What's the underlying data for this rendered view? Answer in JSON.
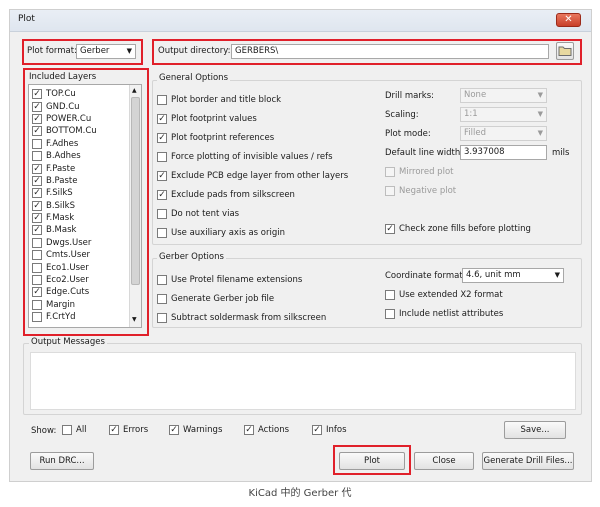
{
  "window": {
    "title": "Plot",
    "close_glyph": "✕"
  },
  "plot_format": {
    "label": "Plot format:",
    "value": "Gerber"
  },
  "output_directory": {
    "label": "Output directory:",
    "value": "GERBERS\\"
  },
  "included_layers": {
    "title": "Included Layers",
    "items": [
      {
        "label": "TOP.Cu",
        "checked": true
      },
      {
        "label": "GND.Cu",
        "checked": true
      },
      {
        "label": "POWER.Cu",
        "checked": true
      },
      {
        "label": "BOTTOM.Cu",
        "checked": true
      },
      {
        "label": "F.Adhes",
        "checked": false
      },
      {
        "label": "B.Adhes",
        "checked": false
      },
      {
        "label": "F.Paste",
        "checked": true
      },
      {
        "label": "B.Paste",
        "checked": true
      },
      {
        "label": "F.SilkS",
        "checked": true
      },
      {
        "label": "B.SilkS",
        "checked": true
      },
      {
        "label": "F.Mask",
        "checked": true
      },
      {
        "label": "B.Mask",
        "checked": true
      },
      {
        "label": "Dwgs.User",
        "checked": false
      },
      {
        "label": "Cmts.User",
        "checked": false
      },
      {
        "label": "Eco1.User",
        "checked": false
      },
      {
        "label": "Eco2.User",
        "checked": false
      },
      {
        "label": "Edge.Cuts",
        "checked": true
      },
      {
        "label": "Margin",
        "checked": false
      },
      {
        "label": "F.CrtYd",
        "checked": false
      }
    ]
  },
  "general_options": {
    "title": "General Options",
    "checkboxes": [
      {
        "label": "Plot border and title block",
        "checked": false
      },
      {
        "label": "Plot footprint values",
        "checked": true
      },
      {
        "label": "Plot footprint references",
        "checked": true
      },
      {
        "label": "Force plotting of invisible values / refs",
        "checked": false
      },
      {
        "label": "Exclude PCB edge layer from other layers",
        "checked": true
      },
      {
        "label": "Exclude pads from silkscreen",
        "checked": true
      },
      {
        "label": "Do not tent vias",
        "checked": false
      },
      {
        "label": "Use auxiliary axis as origin",
        "checked": false
      }
    ],
    "drill_marks": {
      "label": "Drill marks:",
      "value": "None"
    },
    "scaling": {
      "label": "Scaling:",
      "value": "1:1"
    },
    "plot_mode": {
      "label": "Plot mode:",
      "value": "Filled"
    },
    "line_width": {
      "label": "Default line width:",
      "value": "3.937008",
      "unit": "mils"
    },
    "mirrored_plot": {
      "label": "Mirrored plot",
      "checked": false
    },
    "negative_plot": {
      "label": "Negative plot",
      "checked": false
    },
    "check_zone_fills": {
      "label": "Check zone fills before plotting",
      "checked": true
    }
  },
  "gerber_options": {
    "title": "Gerber Options",
    "checkboxes": [
      {
        "label": "Use Protel filename extensions",
        "checked": false
      },
      {
        "label": "Generate Gerber job file",
        "checked": false
      },
      {
        "label": "Subtract soldermask from silkscreen",
        "checked": false
      }
    ],
    "coordinate_format": {
      "label": "Coordinate format:",
      "value": "4.6, unit mm"
    },
    "extended_x2": {
      "label": "Use extended X2 format",
      "checked": false
    },
    "netlist_attributes": {
      "label": "Include netlist attributes",
      "checked": false
    }
  },
  "output_messages": {
    "title": "Output Messages"
  },
  "show_filter": {
    "label": "Show:",
    "items": [
      {
        "label": "All",
        "checked": false
      },
      {
        "label": "Errors",
        "checked": true
      },
      {
        "label": "Warnings",
        "checked": true
      },
      {
        "label": "Actions",
        "checked": true
      },
      {
        "label": "Infos",
        "checked": true
      }
    ]
  },
  "buttons": {
    "save": "Save...",
    "run_drc": "Run DRC...",
    "plot": "Plot",
    "close": "Close",
    "generate_drill": "Generate Drill Files..."
  },
  "caption": "KiCad 中的 Gerber 代",
  "icons": {
    "check": "✓",
    "dropdown": "▼",
    "scroll_up": "▲",
    "scroll_down": "▼"
  }
}
